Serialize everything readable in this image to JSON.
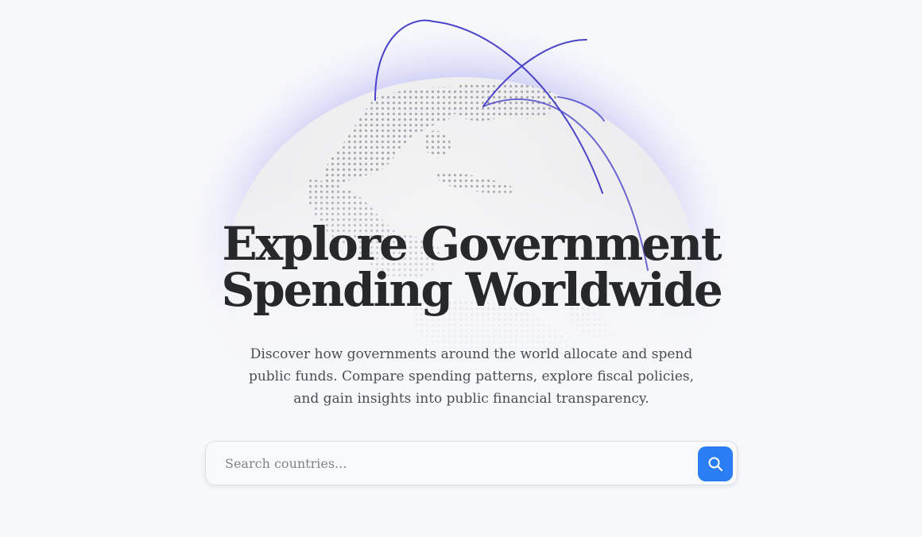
{
  "hero": {
    "title_line1": "Explore Government",
    "title_line2": "Spending Worldwide",
    "description": "Discover how governments around the world allocate and spend public funds. Compare spending patterns, explore fiscal policies, and gain insights into public financial transparency."
  },
  "search": {
    "placeholder": "Search countries...",
    "value": "",
    "button_icon": "search-icon"
  },
  "colors": {
    "accent": "#2a7df2",
    "arc": "#4a43c8",
    "glow": "#8f8cf0",
    "title": "#27282b",
    "text": "#4a4d55"
  },
  "globe": {
    "icon": "dotted-globe-illustration"
  }
}
